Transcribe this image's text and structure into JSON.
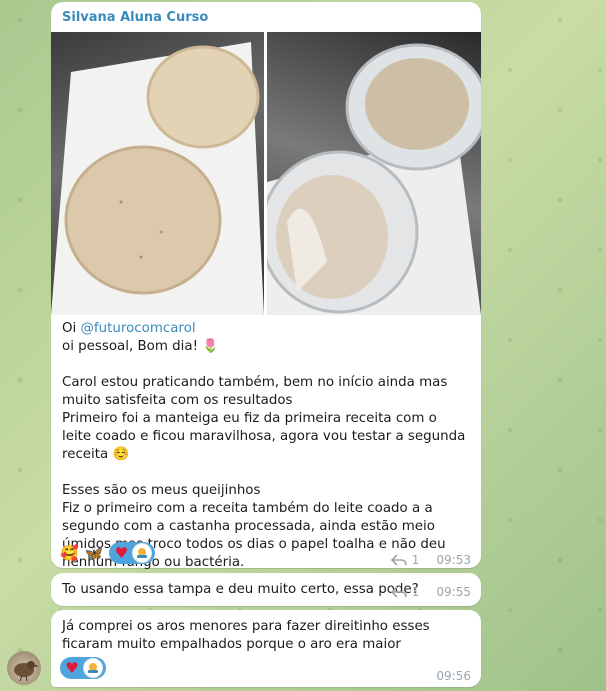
{
  "colors": {
    "accent": "#3a8bbd",
    "bubble": "#ffffff",
    "reaction_pill": "#4ea4dd",
    "heart": "#e0183a",
    "meta": "#9aa6b0"
  },
  "messages": [
    {
      "sender": "Silvana Aluna Curso",
      "mention_prefix": "Oi ",
      "mention": "@futurocomcarol",
      "text": "oi pessoal, Bom dia! 🌷\n\nCarol estou praticando também, bem no início ainda mas muito satisfeita com os resultados\nPrimeiro foi a manteiga eu fiz da primeira receita com o leite coado e ficou maravilhosa, agora vou testar a segunda receita ☺️\n\nEsses são os meus queijinhos\nFiz o primeiro com a receita também do leite coado a a segundo com a castanha processada, ainda estão meio úmidos mas troco todos os dias o papel toalha e não deu nenhum fungo ou bactéria.",
      "reactions": [
        "🥰",
        "🦋"
      ],
      "heart": "♥",
      "replies": "1",
      "time": "09:53"
    },
    {
      "text": "To usando essa tampa e deu muito certo, essa pode?",
      "replies": "1",
      "time": "09:55"
    },
    {
      "text": "Já comprei os aros menores para fazer direitinho esses ficaram muito empalhados porque o aro era maior",
      "heart": "♥",
      "time": "09:56"
    }
  ]
}
